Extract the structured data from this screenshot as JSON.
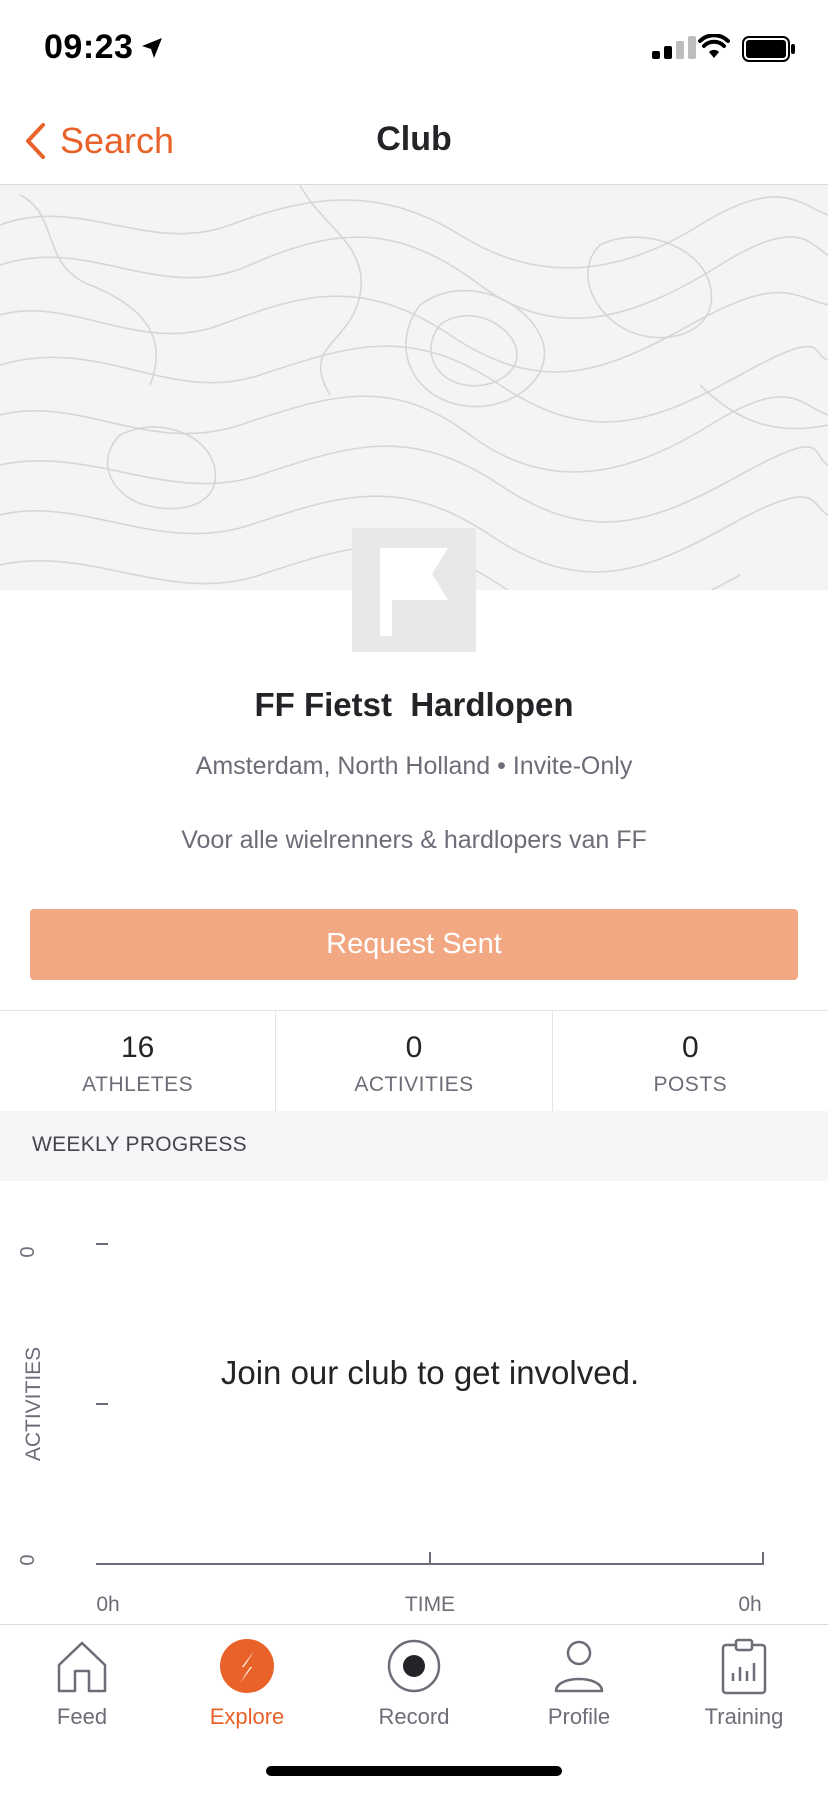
{
  "status_bar": {
    "time": "09:23"
  },
  "nav": {
    "back_label": "Search",
    "title": "Club"
  },
  "club": {
    "name": "FF Fietst  Hardlopen",
    "meta": "Amsterdam, North Holland • Invite-Only",
    "description": "Voor alle wielrenners & hardlopers van FF",
    "request_button": "Request Sent"
  },
  "stats": [
    {
      "value": "16",
      "label": "ATHLETES"
    },
    {
      "value": "0",
      "label": "ACTIVITIES"
    },
    {
      "value": "0",
      "label": "POSTS"
    }
  ],
  "weekly_progress": {
    "heading": "WEEKLY PROGRESS",
    "y_axis_label": "ACTIVITIES",
    "y_ticks": [
      "0",
      "0"
    ],
    "x_axis_label": "TIME",
    "x_ticks": [
      "0h",
      "0h"
    ],
    "empty_message": "Join our club to get involved."
  },
  "tabbar": {
    "items": [
      {
        "label": "Feed",
        "icon": "home-icon"
      },
      {
        "label": "Explore",
        "icon": "compass-icon",
        "active": true
      },
      {
        "label": "Record",
        "icon": "record-icon"
      },
      {
        "label": "Profile",
        "icon": "person-icon"
      },
      {
        "label": "Training",
        "icon": "clipboard-chart-icon"
      }
    ]
  },
  "colors": {
    "accent": "#e8622a",
    "button_disabled": "#f3a884",
    "text": "#242428",
    "muted": "#6d6d78"
  }
}
